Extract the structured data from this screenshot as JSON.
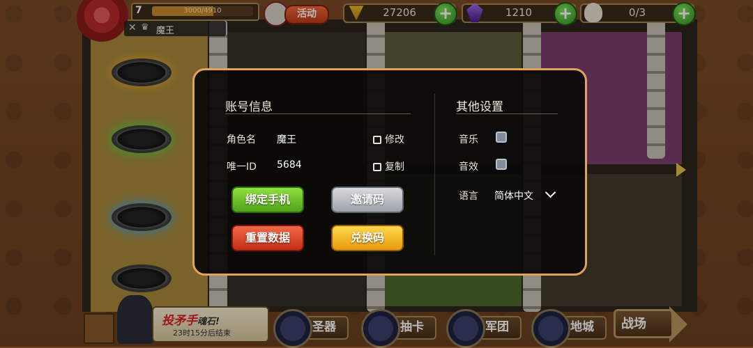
{
  "hud": {
    "level": "7",
    "xp_text": "3000/4910",
    "xp_progress": 0.61,
    "event_label": "活动",
    "gold": "27206",
    "gems": "1210",
    "population": "0/3",
    "plus": "+",
    "boss_name": "魔王"
  },
  "settings": {
    "account_title": "账号信息",
    "other_title": "其他设置",
    "role_label": "角色名",
    "role_value": "魔王",
    "edit_label": "修改",
    "id_label": "唯一ID",
    "id_value": "5684",
    "copy_label": "复制",
    "bind_phone": "绑定手机",
    "invite_code": "邀请码",
    "reset_data": "重置数据",
    "redeem_code": "兑换码",
    "music_label": "音乐",
    "music_on": false,
    "sfx_label": "音效",
    "sfx_on": false,
    "language_label": "语言",
    "language_value": "简体中文"
  },
  "bottom": {
    "banner_title": "投矛手",
    "banner_subtitle": "魂石!",
    "banner_timer": "23时15分后结束",
    "nav": [
      "圣器",
      "抽卡",
      "军团",
      "地城"
    ],
    "battle": "战场"
  },
  "colors": {
    "modal_border": "#e3a25a",
    "green_button": "#6cc22a",
    "red_button": "#d8401f",
    "yellow_button": "#f4b82a"
  }
}
